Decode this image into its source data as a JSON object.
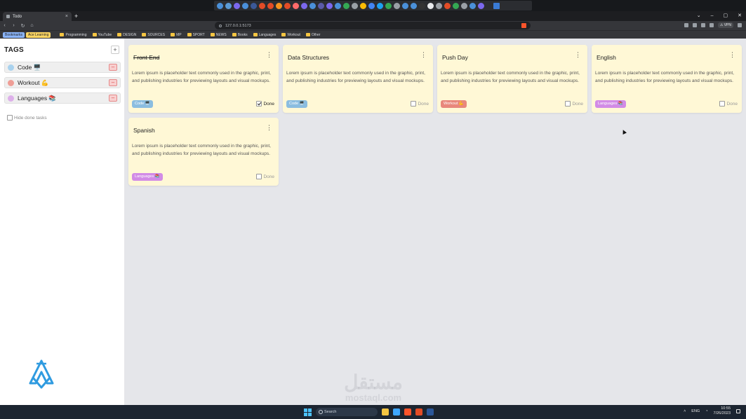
{
  "browser": {
    "tab_title": "Todo",
    "tab_close": "×",
    "new_tab": "+",
    "window_controls": [
      "⌄",
      "–",
      "▢",
      "✕"
    ],
    "url": "127.0.0.1:5173",
    "nav": {
      "back": "‹",
      "forward": "›",
      "reload": "↻",
      "home": "⌂"
    },
    "toolbar_pill": "⚠ VPN",
    "bookmark_chips": [
      {
        "label": "Bookmarks",
        "color": "#8ab4f8"
      },
      {
        "label": "Ace Learning",
        "color": "#fdd663"
      }
    ],
    "bookmarks": [
      "Programming",
      "YouTube",
      "DESIGN",
      "SOURCES",
      "MP",
      "SPORT",
      "NEWS",
      "Books",
      "Languages",
      "Workout",
      "Other"
    ],
    "extension_colors": [
      "#4a90d9",
      "#5b9bd5",
      "#7b68ee",
      "#4a90d9",
      "#3b5998",
      "#e34c26",
      "#e34c26",
      "#f7931e",
      "#e34c26",
      "#ff6b6b",
      "#7b68ee",
      "#4a90d9",
      "#5a5aa8",
      "#7b68ee",
      "#4a90d9",
      "#34a853",
      "#9aa0a6",
      "#fbbc04",
      "#4285f4",
      "#1da1f2",
      "#34a853",
      "#9aa0a6",
      "#4a90d9",
      "#4a90d9",
      "#333333",
      "#e8eaed",
      "#9aa0a6",
      "#e34c26",
      "#34a853",
      "#9aa0a6",
      "#4a90d9",
      "#7b68ee"
    ]
  },
  "sidebar": {
    "header": "TAGS",
    "add_button": "+",
    "tags": [
      {
        "label": "Code 🖥️",
        "color": "#a9d2ee"
      },
      {
        "label": "Workout 💪",
        "color": "#ef9e96"
      },
      {
        "label": "Languages 📚",
        "color": "#ddb0ea"
      }
    ],
    "remove_label": "–",
    "hide_done_label": "Hide done tasks"
  },
  "tasks": [
    {
      "title": "Front End",
      "description": "Lorem ipsum is placeholder text commonly used in the graphic, print, and publishing industries for previewing layouts and visual mockups.",
      "tag": "Code 🖥️",
      "tag_color": "#8bbde0",
      "done": true,
      "done_label": "Done"
    },
    {
      "title": "Data Structures",
      "description": "Lorem ipsum is placeholder text commonly used in the graphic, print, and publishing industries for previewing layouts and visual mockups.",
      "tag": "Code 🖥️",
      "tag_color": "#8bbde0",
      "done": false,
      "done_label": "Done"
    },
    {
      "title": "Push Day",
      "description": "Lorem ipsum is placeholder text commonly used in the graphic, print, and publishing industries for previewing layouts and visual mockups.",
      "tag": "Workout 💪",
      "tag_color": "#e8877c",
      "done": false,
      "done_label": "Done"
    },
    {
      "title": "English",
      "description": "Lorem ipsum is placeholder text commonly used in the graphic, print, and publishing industries for previewing layouts and visual mockups.",
      "tag": "Languages 📚",
      "tag_color": "#d28be6",
      "done": false,
      "done_label": "Done"
    },
    {
      "title": "Spanish",
      "description": "Lorem ipsum is placeholder text commonly used in the graphic, print, and publishing industries for previewing layouts and visual mockups.",
      "tag": "Languages 📚",
      "tag_color": "#d28be6",
      "done": false,
      "done_label": "Done"
    }
  ],
  "card_menu": "⋮",
  "watermark": {
    "arabic": "مستقل",
    "latin": "mostaql.com"
  },
  "taskbar": {
    "search_placeholder": "Search",
    "tray_lang": "ENG",
    "clock_time": "10:55",
    "clock_date": "7/26/2023",
    "app_colors": [
      "#f5c542",
      "#3ea6ff",
      "#fb542b",
      "#e34c26",
      "#2b579a"
    ]
  },
  "colors": {
    "card_bg": "#fff8d6",
    "app_bg": "#e5e6ea",
    "logo": "#2f9be0"
  }
}
